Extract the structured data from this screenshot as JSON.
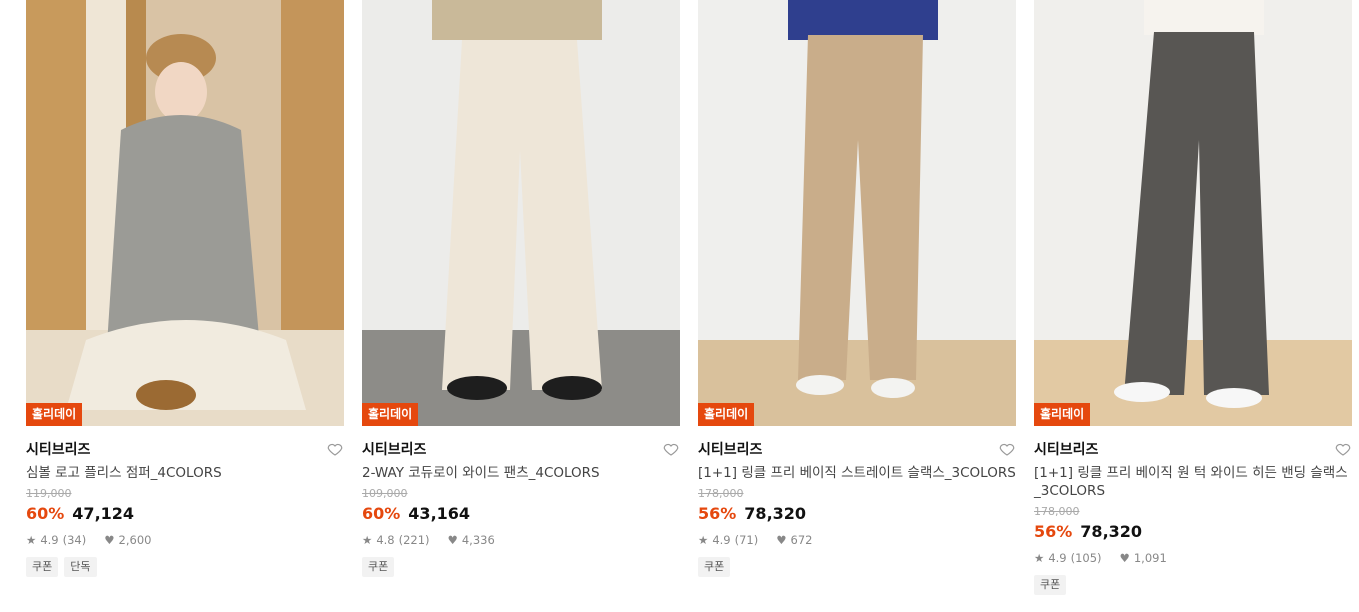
{
  "colors": {
    "accent": "#e5480e"
  },
  "products": [
    {
      "badge": "홀리데이",
      "brand": "시티브리즈",
      "name": "심볼 로고 플리스 점퍼_4COLORS",
      "original_price": "119,000",
      "discount": "60%",
      "price": "47,124",
      "rating": "4.9",
      "reviews": "(34)",
      "likes": "2,600",
      "tags": [
        "쿠폰",
        "단독"
      ]
    },
    {
      "badge": "홀리데이",
      "brand": "시티브리즈",
      "name": "2-WAY 코듀로이 와이드 팬츠_4COLORS",
      "original_price": "109,000",
      "discount": "60%",
      "price": "43,164",
      "rating": "4.8",
      "reviews": "(221)",
      "likes": "4,336",
      "tags": [
        "쿠폰"
      ]
    },
    {
      "badge": "홀리데이",
      "brand": "시티브리즈",
      "name": "[1+1] 링클 프리 베이직 스트레이트 슬랙스_3COLORS",
      "original_price": "178,000",
      "discount": "56%",
      "price": "78,320",
      "rating": "4.9",
      "reviews": "(71)",
      "likes": "672",
      "tags": [
        "쿠폰"
      ]
    },
    {
      "badge": "홀리데이",
      "brand": "시티브리즈",
      "name": "[1+1] 링클 프리 베이직 원 턱 와이드 히든 밴딩 슬랙스_3COLORS",
      "original_price": "178,000",
      "discount": "56%",
      "price": "78,320",
      "rating": "4.9",
      "reviews": "(105)",
      "likes": "1,091",
      "tags": [
        "쿠폰"
      ]
    }
  ]
}
